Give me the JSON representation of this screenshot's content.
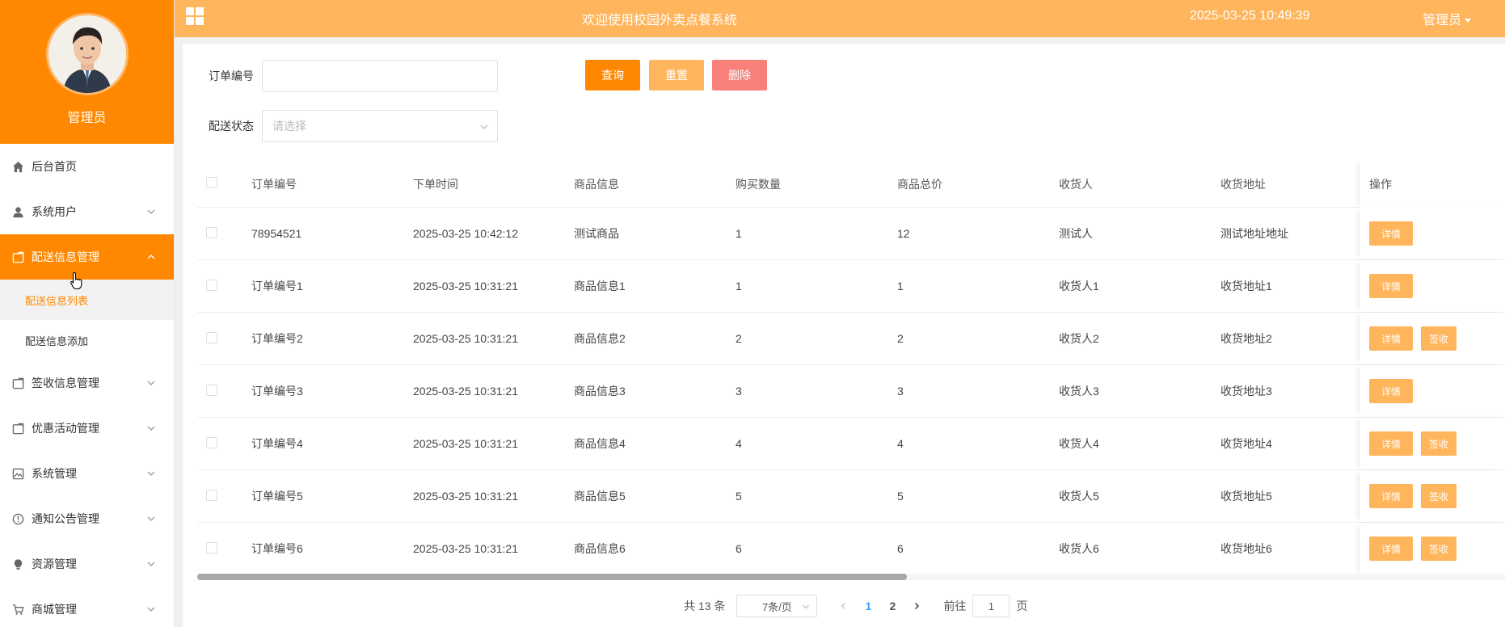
{
  "sidebar": {
    "profile_name": "管理员",
    "items": [
      {
        "label": "后台首页",
        "icon": "home-icon"
      },
      {
        "label": "系统用户",
        "icon": "user-icon"
      },
      {
        "label": "配送信息管理",
        "icon": "folder-icon"
      },
      {
        "label": "签收信息管理",
        "icon": "folder-icon"
      },
      {
        "label": "优惠活动管理",
        "icon": "folder-icon"
      },
      {
        "label": "系统管理",
        "icon": "image-icon"
      },
      {
        "label": "通知公告管理",
        "icon": "info-icon"
      },
      {
        "label": "资源管理",
        "icon": "bulb-icon"
      },
      {
        "label": "商城管理",
        "icon": "cart-icon"
      }
    ],
    "submenu": [
      {
        "label": "配送信息列表"
      },
      {
        "label": "配送信息添加"
      }
    ]
  },
  "header": {
    "title": "欢迎使用校园外卖点餐系统",
    "datetime": "2025-03-25 10:49:39",
    "user": "管理员"
  },
  "filters": {
    "order_no_label": "订单编号",
    "order_no_value": "",
    "status_label": "配送状态",
    "status_placeholder": "请选择",
    "search_label": "查询",
    "reset_label": "重置",
    "delete_label": "删除"
  },
  "table": {
    "columns": [
      "订单编号",
      "下单时间",
      "商品信息",
      "购买数量",
      "商品总价",
      "收货人",
      "收货地址",
      "操作"
    ],
    "detail_label": "详情",
    "sign_label": "签收",
    "rows": [
      {
        "no": "78954521",
        "time": "2025-03-25 10:42:12",
        "goods": "测试商品",
        "qty": "1",
        "total": "12",
        "receiver": "测试人",
        "address": "测试地址地址"
      },
      {
        "no": "订单编号1",
        "time": "2025-03-25 10:31:21",
        "goods": "商品信息1",
        "qty": "1",
        "total": "1",
        "receiver": "收货人1",
        "address": "收货地址1"
      },
      {
        "no": "订单编号2",
        "time": "2025-03-25 10:31:21",
        "goods": "商品信息2",
        "qty": "2",
        "total": "2",
        "receiver": "收货人2",
        "address": "收货地址2"
      },
      {
        "no": "订单编号3",
        "time": "2025-03-25 10:31:21",
        "goods": "商品信息3",
        "qty": "3",
        "total": "3",
        "receiver": "收货人3",
        "address": "收货地址3"
      },
      {
        "no": "订单编号4",
        "time": "2025-03-25 10:31:21",
        "goods": "商品信息4",
        "qty": "4",
        "total": "4",
        "receiver": "收货人4",
        "address": "收货地址4"
      },
      {
        "no": "订单编号5",
        "time": "2025-03-25 10:31:21",
        "goods": "商品信息5",
        "qty": "5",
        "total": "5",
        "receiver": "收货人5",
        "address": "收货地址5"
      },
      {
        "no": "订单编号6",
        "time": "2025-03-25 10:31:21",
        "goods": "商品信息6",
        "qty": "6",
        "total": "6",
        "receiver": "收货人6",
        "address": "收货地址6"
      }
    ]
  },
  "pagination": {
    "total_text": "共 13 条",
    "page_size": "7条/页",
    "pages": [
      "1",
      "2"
    ],
    "current": "1",
    "goto_prefix": "前往",
    "goto_value": "1",
    "goto_suffix": "页"
  },
  "colors": {
    "primary": "#ff8800",
    "header": "#ffb55c",
    "danger": "#f7817a",
    "page_active": "#409eff"
  }
}
